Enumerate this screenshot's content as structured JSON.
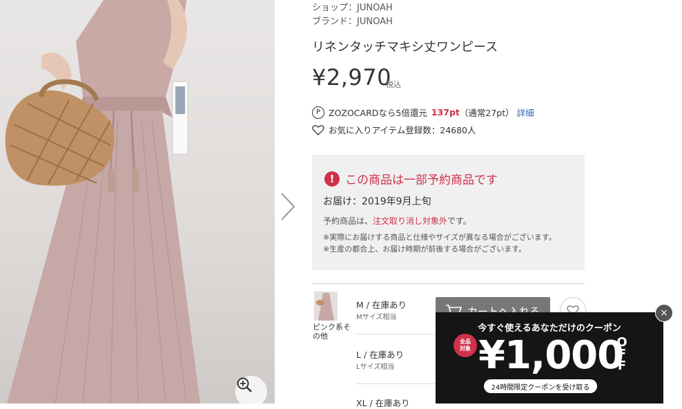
{
  "product": {
    "shop": "ショップ：JUNOAH",
    "brand": "ブランド：JUNOAH",
    "title": "リネンタッチマキシ丈ワンピース",
    "price": "¥2,970",
    "tax_label": "税込"
  },
  "points": {
    "badge": "P",
    "text": "ZOZOCARDなら5倍還元",
    "amount": "137pt",
    "normal": "（通常27pt）",
    "detail_link": "詳細"
  },
  "favorite": {
    "text": "お気に入りアイテム登録数：24680人"
  },
  "notice": {
    "icon": "!",
    "title": "この商品は一部予約商品です",
    "delivery": "お届け：2019年9月上旬",
    "reservation_prefix": "予約商品は、",
    "reservation_link": "注文取り消し対象外",
    "reservation_suffix": "です。",
    "note1": "※実際にお届けする商品と仕様やサイズが異なる場合がございます。",
    "note2": "※生産の都合上、お届け時期が前後する場合がございます。"
  },
  "variant": {
    "color": "ピンク系その他",
    "sizes": [
      {
        "label": "M / 在庫あり",
        "sub": "Mサイズ相当"
      },
      {
        "label": "L / 在庫あり",
        "sub": "Lサイズ相当"
      },
      {
        "label": "XL / 在庫あり",
        "sub": ""
      }
    ]
  },
  "cart_button": "カートへ入れる",
  "coupon": {
    "headline": "今すぐ使えるあなただけのクーポン",
    "badge_line1": "全品",
    "badge_line2": "対象",
    "amount": "¥1,000",
    "off": "OFF",
    "cta": "24時間限定クーポンを受け取る",
    "close": "×"
  },
  "icons": {
    "zoom": "zoom-in-icon",
    "next": "chevron-right-icon",
    "heart": "heart-icon",
    "cart": "cart-icon"
  },
  "colors": {
    "accent_red": "#d0304a",
    "link_blue": "#2a6ab0",
    "cart_gray": "#777777",
    "coupon_bg": "#151515"
  }
}
